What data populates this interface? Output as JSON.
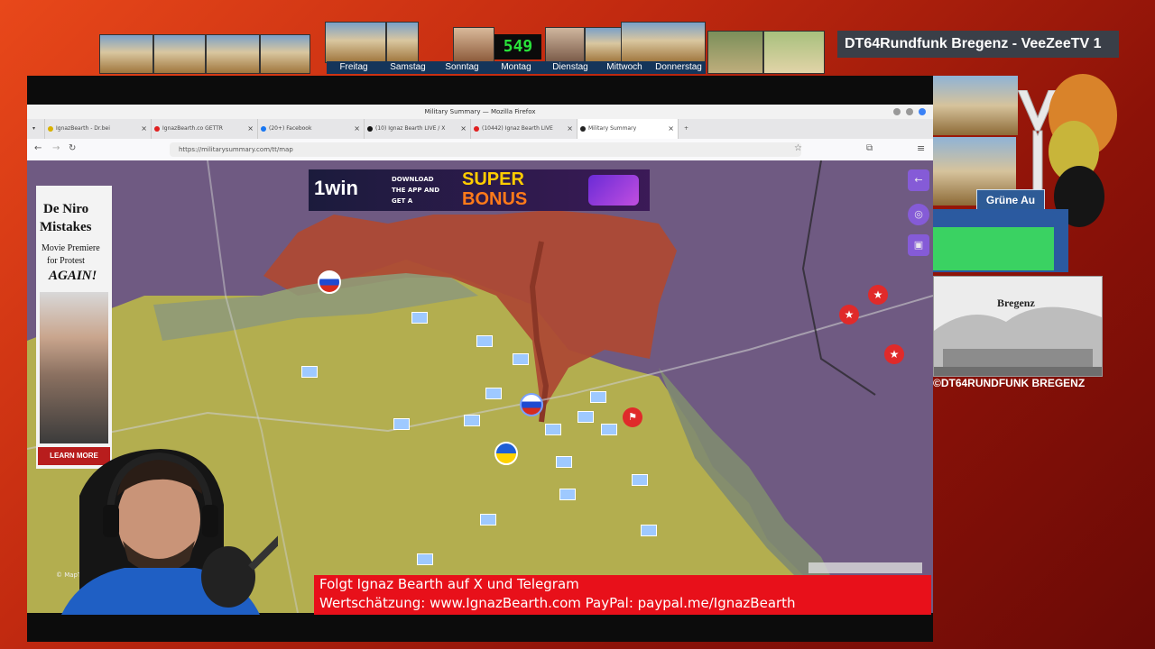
{
  "top_strip": {
    "days": [
      "Freitag",
      "Samstag",
      "Sonntag",
      "Montag",
      "Dienstag",
      "Mittwoch",
      "Donnerstag"
    ],
    "counter": "549",
    "station_title": "DT64Rundfunk Bregenz - VeeZeeTV 1"
  },
  "browser": {
    "window_title": "Military Summary — Mozilla Firefox",
    "tabs": [
      {
        "label": "IgnazBearth - Dr.bei",
        "icon": "coin-icon",
        "color": "#d8b100"
      },
      {
        "label": "IgnazBearth.co GETTR",
        "icon": "video-icon",
        "color": "#e02020"
      },
      {
        "label": "(20+) Facebook",
        "icon": "facebook-icon",
        "color": "#1877f2"
      },
      {
        "label": "(10) Ignaz Bearth LIVE / X",
        "icon": "x-icon",
        "color": "#111111"
      },
      {
        "label": "(10442) Ignaz Bearth LIVE",
        "icon": "youtube-icon",
        "color": "#e02020"
      },
      {
        "label": "Military Summary",
        "icon": "globe-icon",
        "color": "#222222",
        "active": true
      }
    ],
    "url": "https://militarysummary.com/tt/map"
  },
  "map": {
    "attribution": "© MapTiler",
    "colors": {
      "ukraine": "#c8c05a",
      "russia": "#b04a36",
      "background": "#6f5a82",
      "gray": "#8f8f82"
    }
  },
  "banner_ad": {
    "brand": "1win",
    "line1": "DOWNLOAD",
    "line2": "THE APP AND",
    "line3": "GET A",
    "headline1": "SUPER",
    "headline2": "BONUS"
  },
  "side_ad": {
    "title_line1": "De Niro",
    "title_line2": "Mistakes",
    "subtitle_line1": "Movie Premiere",
    "subtitle_line2": "for Protest",
    "emphasis": "AGAIN!",
    "cta": "LEARN MORE"
  },
  "overlay": {
    "line1": "Folgt Ignaz Bearth auf X und Telegram",
    "line2": "Wertschätzung: www.IgnazBearth.com PayPal: paypal.me/IgnazBearth"
  },
  "right_panel": {
    "badge": "Grüne Au",
    "image_caption": "Bregenz",
    "copyright": "©DT64RUNDFUNK BREGENZ"
  }
}
